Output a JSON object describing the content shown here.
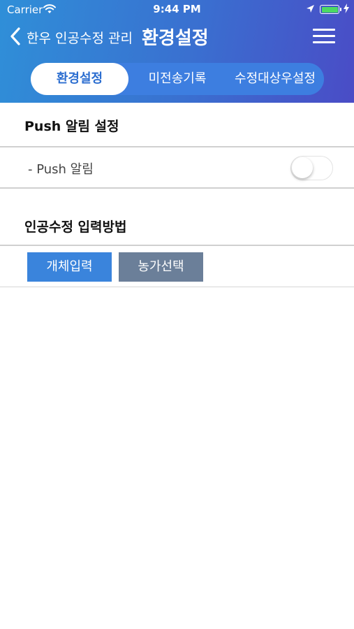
{
  "status_bar": {
    "carrier": "Carrier",
    "time": "9:44 PM"
  },
  "nav": {
    "back_label": "한우 인공수정 관리",
    "title": "환경설정"
  },
  "segments": [
    {
      "label": "환경설정",
      "active": true
    },
    {
      "label": "미전송기록",
      "active": false
    },
    {
      "label": "수정대상우설정",
      "active": false
    }
  ],
  "push_section": {
    "title": "Push 알림 설정",
    "row_label": "- Push 알림",
    "toggle_on": false
  },
  "input_section": {
    "title": "인공수정 입력방법",
    "buttons": [
      "개체입력",
      "농가선택"
    ]
  },
  "colors": {
    "header_start": "#2f8fd8",
    "header_end": "#4a4cc6",
    "primary_button": "#3a84dc",
    "secondary_button": "#6b7f99"
  }
}
